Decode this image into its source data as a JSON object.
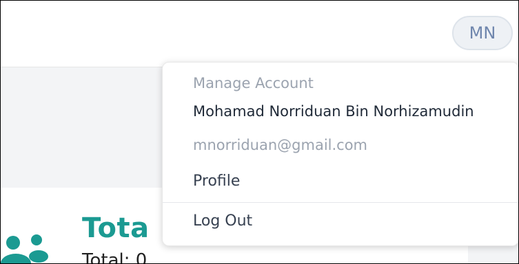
{
  "header": {
    "avatar_initials": "MN"
  },
  "account_menu": {
    "header": "Manage Account",
    "user_name": "Mohamad Norriduan Bin Norhizamudin",
    "user_email": "mnorriduan@gmail.com",
    "items": [
      {
        "label": "Profile"
      },
      {
        "label": "Log Out"
      }
    ]
  },
  "card": {
    "title": "Tota",
    "subtitle": "Total: 0",
    "icon": "users-icon",
    "accent_color": "#1b9a92"
  }
}
